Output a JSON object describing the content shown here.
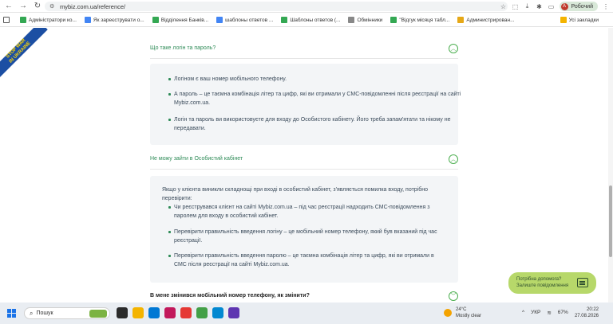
{
  "browser": {
    "url": "mybiz.com.ua/reference/",
    "profile_initial": "А",
    "profile_label": "Робочий",
    "bookmarks": [
      {
        "label": "Адміністратори ко...",
        "icon": "green"
      },
      {
        "label": "Як зареєструвати о...",
        "icon": "blue"
      },
      {
        "label": "Відділення Банків...",
        "icon": "green"
      },
      {
        "label": "шаблоны ответов ...",
        "icon": "blue"
      },
      {
        "label": "Шаблоны ответов (...",
        "icon": "green"
      },
      {
        "label": "Обмінники",
        "icon": "grey"
      },
      {
        "label": "\"Відгук місяця табл...",
        "icon": "green"
      },
      {
        "label": "Администрирован...",
        "icon": "gold"
      }
    ],
    "all_bookmarks": "Усі закладки"
  },
  "ribbon": {
    "line1": "STOP WAR",
    "line2": "IN UKRAINE"
  },
  "faq": {
    "q1": "Що таке логін та пароль?",
    "q1_bullets": [
      "Логіном є ваш номер мобільного телефону.",
      "А пароль – це таємна комбінація літер та цифр, які ви отримали у СМС-повідомленні після реєстрації на сайті Mybiz.com.ua.",
      "Логін та пароль ви використовуєте для входу до Особистого кабінету. Його треба запам'ятати та нікому не передавати."
    ],
    "q2": "Не можу зайти в Особистий кабінет",
    "q2_intro": "Якщо у клієнта виникли складнощі при вході в особистий кабінет, з'являється помилка входу, потрібно перевірити:",
    "q2_bullets": [
      "Чи реєструвався клієнт на сайті Mybiz.com.ua – під час реєстрації надходить СМС-повідомлення з паролем для входу в особистий кабінет.",
      "Перевірити правильність введення логіну – це мобільний номер телефону, який був вказаний під час реєстрації.",
      "Перевірити правильність введення паролю – це таємна комбінація літер та цифр, які ви отримали в СМС після реєстрації на сайті Mybiz.com.ua."
    ],
    "q3": "В мене змінився мобільний номер телефону, як змінити?"
  },
  "help_widget": {
    "line1": "Потрібна допомога?",
    "line2": "Залиште повідомлення"
  },
  "taskbar": {
    "search_placeholder": "Пошук",
    "weather_temp": "24°C",
    "weather_desc": "Mostly clear",
    "lang": "УКР",
    "battery": "67%",
    "time": "20:22",
    "date": "27.08.2026"
  },
  "colors": {
    "accent_green": "#2e8b57",
    "help_bg": "#b7d86a",
    "answer_bg": "#f3f5f7"
  }
}
